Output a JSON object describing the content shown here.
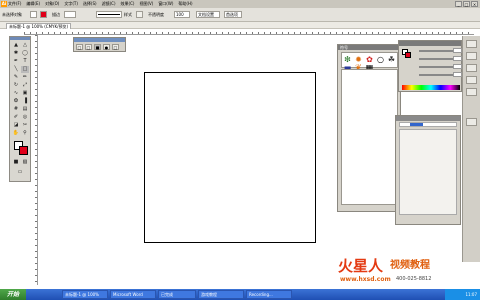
{
  "app": {
    "logo": "Ai"
  },
  "menu": [
    "文件(F)",
    "编辑(E)",
    "对象(O)",
    "文字(T)",
    "选择(S)",
    "滤镜(C)",
    "效果(C)",
    "视图(V)",
    "窗口(W)",
    "帮助(H)"
  ],
  "window_controls": [
    "_",
    "□",
    "×"
  ],
  "control_bar": {
    "label_object": "未选择对象",
    "label_stroke": "描边",
    "style_label": "样式",
    "opacity_label": "不透明度",
    "opacity_value": "100",
    "doc_setup": "文档设置",
    "prefs": "首选项"
  },
  "doc_tab": "未标题-1 @ 100% (CMYK/预览)",
  "symbols_panel": {
    "title": "符号",
    "footer": "   "
  },
  "taskbar": {
    "start": "开始",
    "tasks": [
      "未标题-1 @ 100%",
      "Microsoft Word",
      "已完成",
      "游戏教程",
      "Recording..."
    ],
    "clock": "11:07"
  },
  "watermark": {
    "main": "火星人",
    "sub": "视频教程",
    "url": "www.hxsd.com",
    "phone": "400-025-8812"
  },
  "colors": {
    "accent_stroke": "#e0001a",
    "watermark": "#e43a12",
    "taskbar": "#245edb"
  },
  "icons": {
    "tools": [
      "selection-arrow-icon",
      "direct-select-icon",
      "magic-wand-icon",
      "lasso-icon",
      "pen-icon",
      "type-icon",
      "line-icon",
      "rect-icon",
      "brush-icon",
      "pencil-icon",
      "rotate-icon",
      "scale-icon",
      "warp-icon",
      "free-transform-icon",
      "symbol-sprayer-icon",
      "graph-icon",
      "mesh-icon",
      "gradient-icon",
      "eyedropper-icon",
      "blend-icon",
      "live-paint-icon",
      "slice-icon",
      "scissors-icon",
      "hand-icon",
      "zoom-icon"
    ],
    "symbols": [
      "crab-icon",
      "sun-icon",
      "flower-icon",
      "blob-icon",
      "butterfly-icon",
      "zebra-icon",
      "fish-icon",
      "leaf-icon"
    ]
  }
}
